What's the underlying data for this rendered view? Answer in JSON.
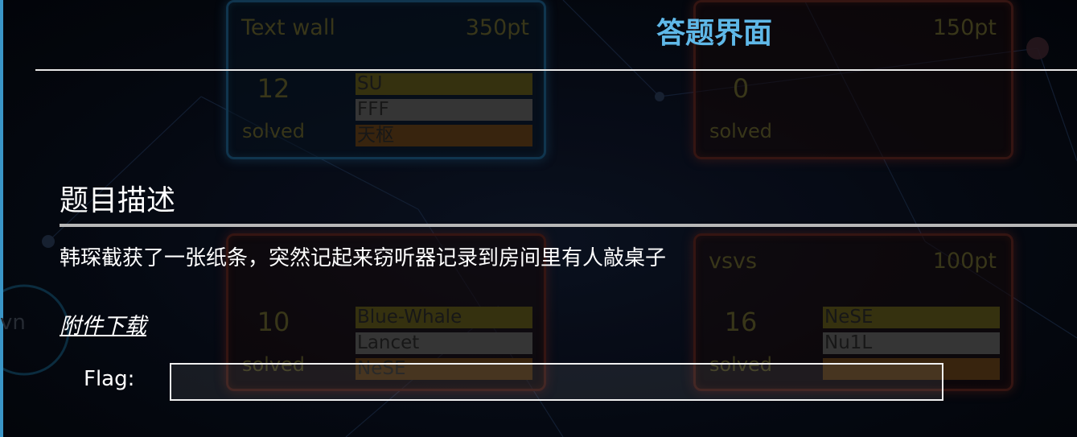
{
  "modal": {
    "title": "答题界面",
    "section_heading": "题目描述",
    "description": "韩琛截获了一张纸条，突然记起来窃听器记录到房间里有人敲桌子",
    "attachment_link": "附件下载",
    "flag_label": "Flag:",
    "flag_value": "",
    "flag_placeholder": ""
  },
  "background": {
    "edge_text": "vn",
    "cards": [
      {
        "name": "Text wall",
        "points": "350pt",
        "count": "12",
        "solved_label": "solved",
        "teams": [
          "SU",
          "FFF",
          "天枢"
        ],
        "theme": "blue"
      },
      {
        "name": "",
        "points": "150pt",
        "count": "0",
        "solved_label": "solved",
        "teams": [],
        "theme": "red"
      },
      {
        "name": "",
        "points": "",
        "count": "10",
        "solved_label": "solved",
        "teams": [
          "Blue-Whale",
          "Lancet",
          "NeSE"
        ],
        "theme": "red"
      },
      {
        "name": "vsvs",
        "points": "100pt",
        "count": "16",
        "solved_label": "solved",
        "teams": [
          "NeSE",
          "Nu1L",
          ""
        ],
        "theme": "red"
      }
    ]
  },
  "colors": {
    "accent": "#5fb8e8",
    "left_edge": "#3fa2d8",
    "text": "#ffffff",
    "rule": "#b8b8b8"
  }
}
